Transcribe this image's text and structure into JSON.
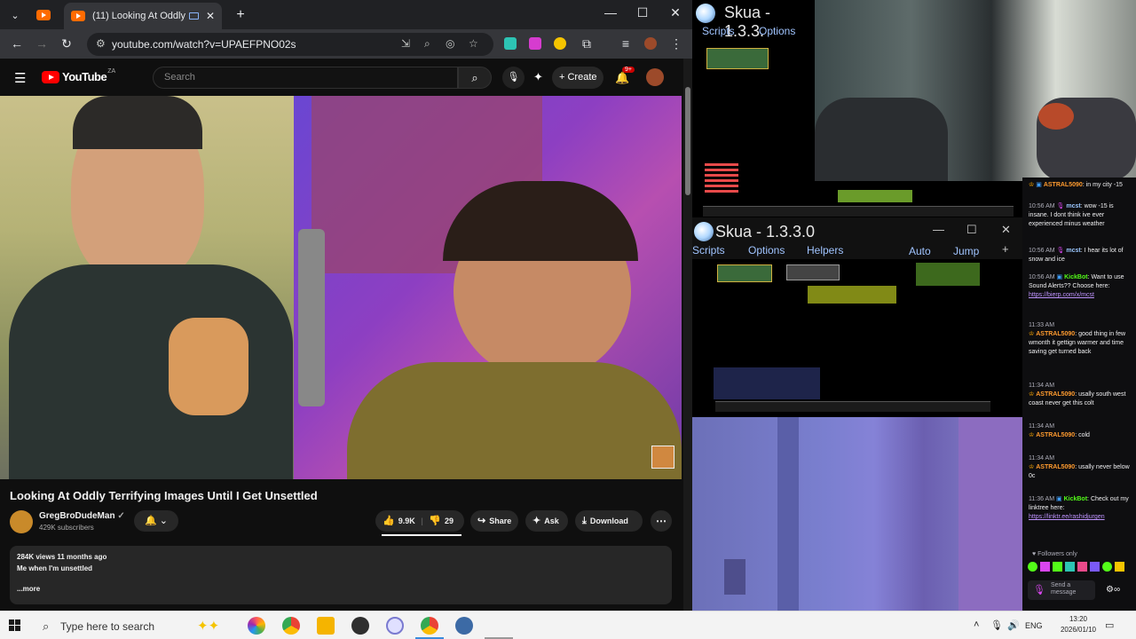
{
  "browser": {
    "tab_title": "(11) Looking At Oddly Terrifying Images Until I Get Unsettled",
    "url": "youtube.com/watch?v=UPAEFPNO02s"
  },
  "youtube": {
    "logo": "YouTube",
    "region": "ZA",
    "search_placeholder": "Search",
    "create_label": "Create",
    "notifications": "9+",
    "video_title": "Looking At Oddly Terrifying Images Until I Get Unsettled",
    "channel_name": "GregBroDudeMan",
    "subscribers": "429K subscribers",
    "likes": "9.9K",
    "dislikes": "29",
    "share": "Share",
    "ask": "Ask",
    "download": "Download",
    "views_date": "284K views  11 months ago",
    "description": "Me when I'm unsettled",
    "more": "...more"
  },
  "skua_top": {
    "title": "Skua - 1.3.3.",
    "menu": [
      "Scripts",
      "Options"
    ]
  },
  "skua_bottom": {
    "title": "Skua - 1.3.3.0",
    "menu": [
      "Scripts",
      "Options",
      "Helpers"
    ],
    "right_menu": [
      "Auto",
      "Jump"
    ]
  },
  "chat": {
    "messages": [
      {
        "time": "",
        "user": "ASTRAL5090",
        "text": "in my city -15",
        "user_color": "#ff9b2f"
      },
      {
        "time": "10:56 AM",
        "user": "mcst",
        "text": "wow -15 is insane. I dont think ive ever experienced minus weather",
        "user_color": "#9bc7ff"
      },
      {
        "time": "10:56 AM",
        "user": "mcst",
        "text": "I hear its lot of snow and ice",
        "user_color": "#9bc7ff"
      },
      {
        "time": "10:56 AM",
        "user": "KickBot",
        "text": "Want to use Sound Alerts?? Choose here:",
        "link": "https://bierp.com/x/mcst",
        "user_color": "#53fc18"
      },
      {
        "time": "11:33 AM",
        "user": "ASTRAL5090",
        "text": "good thing in few wmonth it gettign warmer and time saving get turned back",
        "user_color": "#ff9b2f"
      },
      {
        "time": "11:34 AM",
        "user": "ASTRAL5090",
        "text": "usally south west coast never get this colt",
        "user_color": "#ff9b2f"
      },
      {
        "time": "11:34 AM",
        "user": "ASTRAL5090",
        "text": "cold",
        "user_color": "#ff9b2f"
      },
      {
        "time": "11:34 AM",
        "user": "ASTRAL5090",
        "text": "usally never below 0c",
        "user_color": "#ff9b2f"
      },
      {
        "time": "11:36 AM",
        "user": "KickBot",
        "text": "Check out my linktree here:",
        "link": "https://linktr.ee/rashidjurgen",
        "user_color": "#53fc18"
      }
    ],
    "followers_only": "Followers only",
    "send_placeholder": "Send a message"
  },
  "taskbar": {
    "search": "Type here to search",
    "language": "ENG",
    "time": "13:20",
    "date": "2026/01/10"
  }
}
